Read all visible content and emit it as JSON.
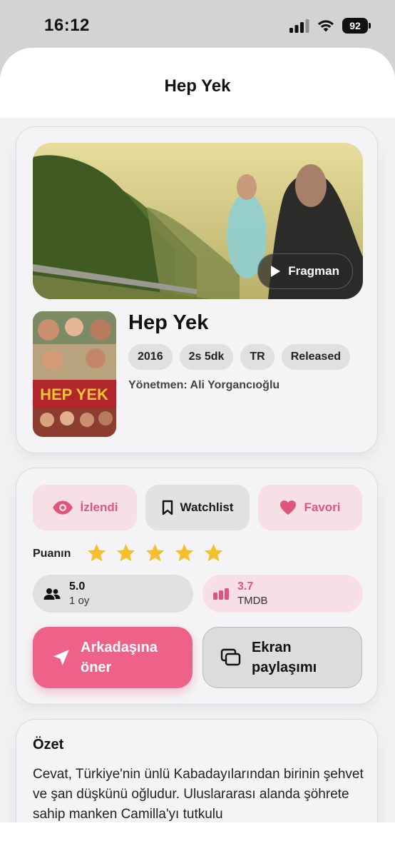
{
  "status_bar": {
    "time": "16:12",
    "battery": "92"
  },
  "header": {
    "title": "Hep Yek"
  },
  "movie": {
    "trailer_label": "Fragman",
    "title": "Hep Yek",
    "chips": [
      "2016",
      "2s 5dk",
      "TR",
      "Released"
    ],
    "director": "Yönetmen: Ali Yorgancıoğlu",
    "poster_text": "HEP YEK"
  },
  "actions": {
    "watched_label": "İzlendi",
    "watchlist_label": "Watchlist",
    "favorite_label": "Favori",
    "rating_label": "Puanın",
    "user_rating_stars": 5,
    "user_score": {
      "value": "5.0",
      "votes": "1 oy"
    },
    "tmdb_score": {
      "value": "3.7",
      "source": "TMDB"
    },
    "recommend_label": "Arkadaşına öner",
    "screen_share_label": "Ekran paylaşımı"
  },
  "summary": {
    "title": "Özet",
    "text": "Cevat, Türkiye'nin ünlü Kabadayılarından birinin şehvet ve şan düşkünü oğludur. Uluslararası alanda şöhrete sahip manken Camilla'yı tutkulu"
  },
  "colors": {
    "accent": "#ee6189",
    "accent_soft": "#f6dfe5",
    "star": "#f5c02c"
  }
}
